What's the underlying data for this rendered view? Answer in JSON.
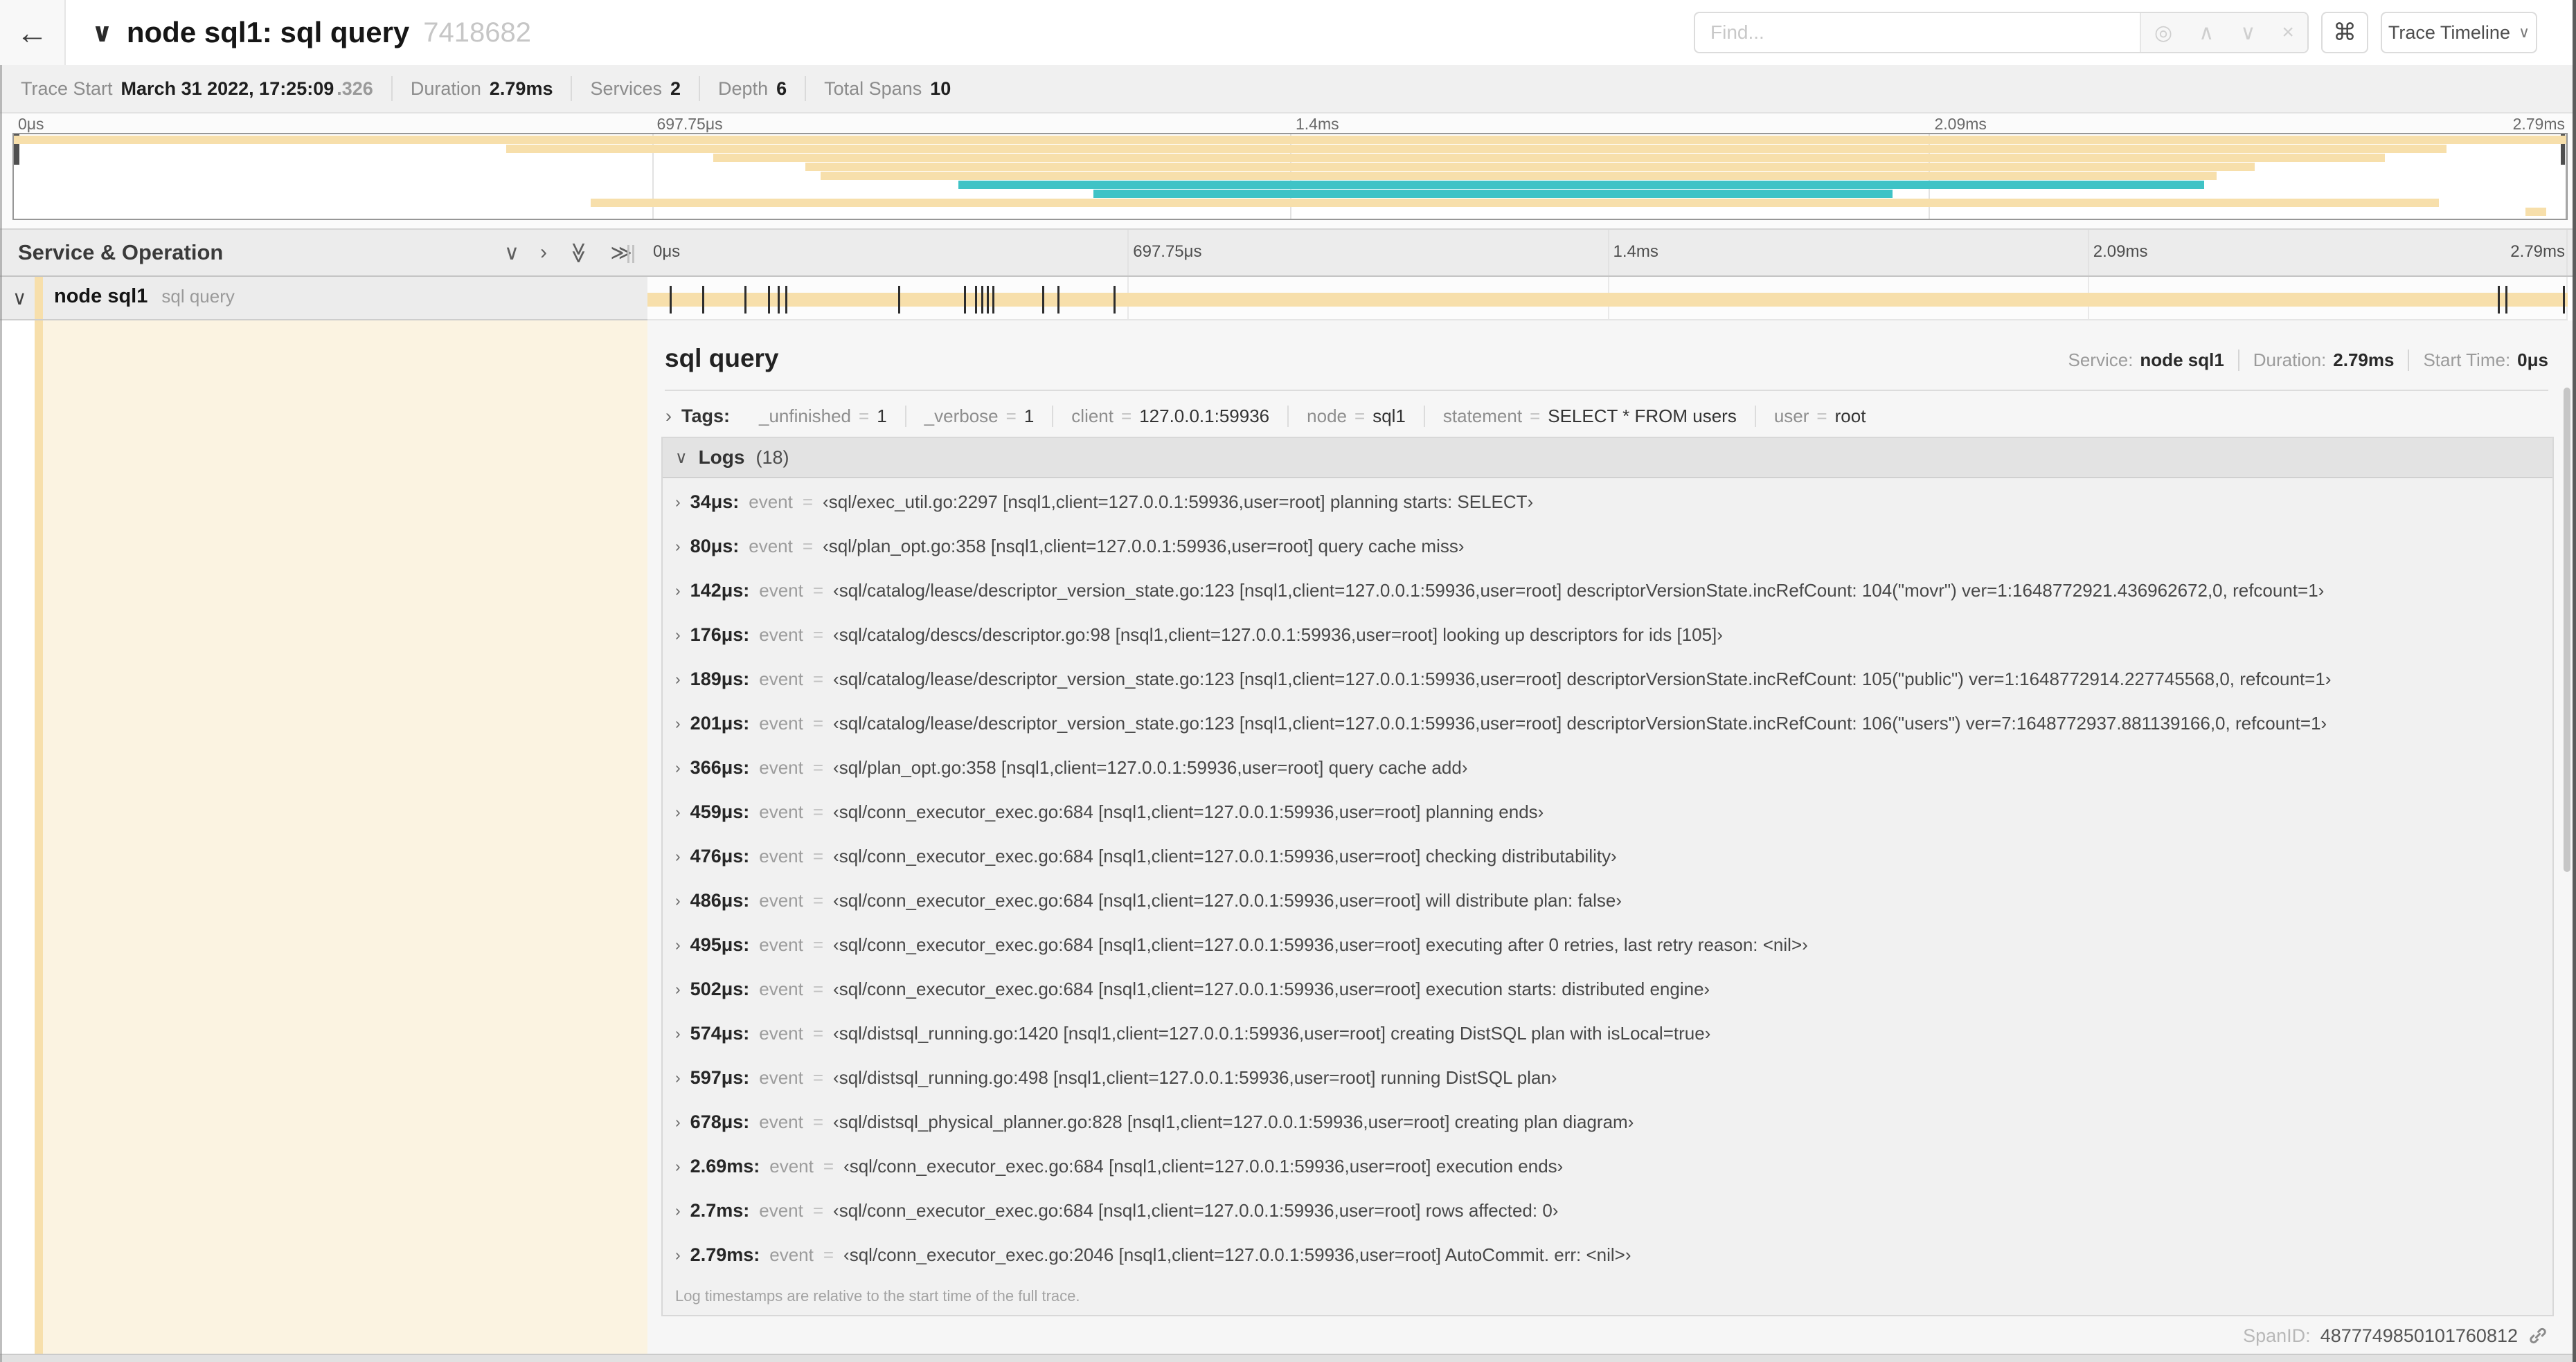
{
  "header": {
    "title": "node sql1: sql query",
    "trace_id": "7418682",
    "find_placeholder": "Find...",
    "view_button": "Trace Timeline"
  },
  "icons": {
    "back": "←",
    "collapse": "∨",
    "find_locate": "◎",
    "find_prev": "∧",
    "find_next": "∨",
    "find_clear": "×",
    "shortcut": "⌘",
    "dropdown": "∨",
    "chevron_right": "›",
    "chevron_down": "∨",
    "collapse_one": "∨",
    "expand_one": "›",
    "collapse_all": "≫",
    "expand_all": "≫",
    "resizer": "||"
  },
  "info_bar": {
    "items": [
      {
        "label": "Trace Start",
        "value": "March 31 2022, 17:25:09",
        "suffix": ".326"
      },
      {
        "label": "Duration",
        "value": "2.79ms"
      },
      {
        "label": "Services",
        "value": "2"
      },
      {
        "label": "Depth",
        "value": "6"
      },
      {
        "label": "Total Spans",
        "value": "10"
      }
    ]
  },
  "colors": {
    "tan": "#f7dfab",
    "teal": "#3fc3c6",
    "cream": "#fbf3e1",
    "tick": "#2d2d2d"
  },
  "minimap": {
    "ticks": [
      {
        "label": "0μs",
        "pct": 0
      },
      {
        "label": "697.75μs",
        "pct": 25
      },
      {
        "label": "1.4ms",
        "pct": 50
      },
      {
        "label": "2.09ms",
        "pct": 75
      },
      {
        "label": "2.79ms",
        "pct": 100,
        "align": "right"
      }
    ],
    "spans": [
      {
        "row": 0,
        "start": 0,
        "end": 100,
        "color": "tan"
      },
      {
        "row": 1,
        "start": 19.3,
        "end": 95.3,
        "color": "tan"
      },
      {
        "row": 2,
        "start": 27.4,
        "end": 92.9,
        "color": "tan"
      },
      {
        "row": 3,
        "start": 31.0,
        "end": 87.8,
        "color": "tan"
      },
      {
        "row": 4,
        "start": 31.6,
        "end": 86.3,
        "color": "tan"
      },
      {
        "row": 5,
        "start": 37.0,
        "end": 85.8,
        "color": "teal"
      },
      {
        "row": 6,
        "start": 42.3,
        "end": 73.6,
        "color": "teal"
      },
      {
        "row": 7,
        "start": 22.6,
        "end": 95.0,
        "color": "tan"
      },
      {
        "row": 8,
        "start": 98.4,
        "end": 99.2,
        "color": "tan"
      }
    ]
  },
  "timeline": {
    "left_header": "Service & Operation",
    "ticks": [
      {
        "label": "0μs",
        "pct": 0
      },
      {
        "label": "697.75μs",
        "pct": 25
      },
      {
        "label": "1.4ms",
        "pct": 50
      },
      {
        "label": "2.09ms",
        "pct": 75
      },
      {
        "label": "2.79ms",
        "pct": 100,
        "align": "right"
      }
    ],
    "row": {
      "service": "node sql1",
      "operation": "sql query"
    }
  },
  "detail": {
    "title": "sql query",
    "meta": [
      {
        "label": "Service:",
        "value": "node sql1"
      },
      {
        "label": "Duration:",
        "value": "2.79ms"
      },
      {
        "label": "Start Time:",
        "value": "0μs"
      }
    ],
    "tags_label": "Tags:",
    "tags": [
      {
        "key": "_unfinished",
        "value": "1"
      },
      {
        "key": "_verbose",
        "value": "1"
      },
      {
        "key": "client",
        "value": "127.0.0.1:59936"
      },
      {
        "key": "node",
        "value": "sql1"
      },
      {
        "key": "statement",
        "value": "SELECT * FROM users"
      },
      {
        "key": "user",
        "value": "root"
      }
    ],
    "logs": {
      "label": "Logs",
      "count": "(18)",
      "field": "event",
      "eq": "=",
      "entries": [
        {
          "time": "34μs:",
          "pct": 1.2,
          "msg": "‹sql/exec_util.go:2297 [nsql1,client=127.0.0.1:59936,user=root] planning starts: SELECT›"
        },
        {
          "time": "80μs:",
          "pct": 2.9,
          "msg": "‹sql/plan_opt.go:358 [nsql1,client=127.0.0.1:59936,user=root] query cache miss›"
        },
        {
          "time": "142μs:",
          "pct": 5.1,
          "msg": "‹sql/catalog/lease/descriptor_version_state.go:123 [nsql1,client=127.0.0.1:59936,user=root] descriptorVersionState.incRefCount: 104(\"movr\") ver=1:1648772921.436962672,0, refcount=1›"
        },
        {
          "time": "176μs:",
          "pct": 6.3,
          "msg": "‹sql/catalog/descs/descriptor.go:98 [nsql1,client=127.0.0.1:59936,user=root] looking up descriptors for ids [105]›"
        },
        {
          "time": "189μs:",
          "pct": 6.8,
          "msg": "‹sql/catalog/lease/descriptor_version_state.go:123 [nsql1,client=127.0.0.1:59936,user=root] descriptorVersionState.incRefCount: 105(\"public\") ver=1:1648772914.227745568,0, refcount=1›"
        },
        {
          "time": "201μs:",
          "pct": 7.2,
          "msg": "‹sql/catalog/lease/descriptor_version_state.go:123 [nsql1,client=127.0.0.1:59936,user=root] descriptorVersionState.incRefCount: 106(\"users\") ver=7:1648772937.881139166,0, refcount=1›"
        },
        {
          "time": "366μs:",
          "pct": 13.1,
          "msg": "‹sql/plan_opt.go:358 [nsql1,client=127.0.0.1:59936,user=root] query cache add›"
        },
        {
          "time": "459μs:",
          "pct": 16.5,
          "msg": "‹sql/conn_executor_exec.go:684 [nsql1,client=127.0.0.1:59936,user=root] planning ends›"
        },
        {
          "time": "476μs:",
          "pct": 17.1,
          "msg": "‹sql/conn_executor_exec.go:684 [nsql1,client=127.0.0.1:59936,user=root] checking distributability›"
        },
        {
          "time": "486μs:",
          "pct": 17.4,
          "msg": "‹sql/conn_executor_exec.go:684 [nsql1,client=127.0.0.1:59936,user=root] will distribute plan: false›"
        },
        {
          "time": "495μs:",
          "pct": 17.7,
          "msg": "‹sql/conn_executor_exec.go:684 [nsql1,client=127.0.0.1:59936,user=root] executing after 0 retries, last retry reason: <nil>›"
        },
        {
          "time": "502μs:",
          "pct": 18.0,
          "msg": "‹sql/conn_executor_exec.go:684 [nsql1,client=127.0.0.1:59936,user=root] execution starts: distributed engine›"
        },
        {
          "time": "574μs:",
          "pct": 20.6,
          "msg": "‹sql/distsql_running.go:1420 [nsql1,client=127.0.0.1:59936,user=root] creating DistSQL plan with isLocal=true›"
        },
        {
          "time": "597μs:",
          "pct": 21.4,
          "msg": "‹sql/distsql_running.go:498 [nsql1,client=127.0.0.1:59936,user=root] running DistSQL plan›"
        },
        {
          "time": "678μs:",
          "pct": 24.3,
          "msg": "‹sql/distsql_physical_planner.go:828 [nsql1,client=127.0.0.1:59936,user=root] creating plan diagram›"
        },
        {
          "time": "2.69ms:",
          "pct": 96.4,
          "msg": "‹sql/conn_executor_exec.go:684 [nsql1,client=127.0.0.1:59936,user=root] execution ends›"
        },
        {
          "time": "2.7ms:",
          "pct": 96.8,
          "msg": "‹sql/conn_executor_exec.go:684 [nsql1,client=127.0.0.1:59936,user=root] rows affected: 0›"
        },
        {
          "time": "2.79ms:",
          "pct": 99.8,
          "msg": "‹sql/conn_executor_exec.go:2046 [nsql1,client=127.0.0.1:59936,user=root] AutoCommit. err: <nil>›"
        }
      ],
      "footnote": "Log timestamps are relative to the start time of the full trace."
    },
    "footer": {
      "label": "SpanID:",
      "value": "4877749850101760812"
    }
  }
}
